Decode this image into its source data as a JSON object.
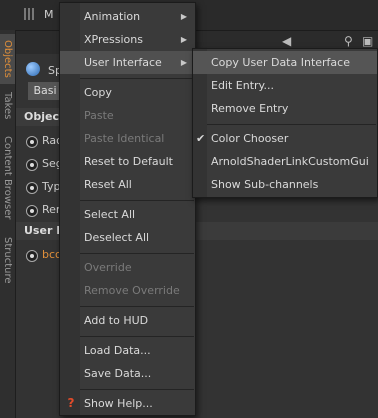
{
  "app": {
    "panel_title": "M",
    "object_prefix": "Sp",
    "basic_tab": "Basi",
    "object_section": "Objec",
    "fields": [
      "Rad",
      "Seg",
      "Typ",
      "Ren"
    ],
    "user_data_section": "User D",
    "user_field": "bco",
    "side_tabs": [
      "Objects",
      "Takes",
      "Content Browser",
      "Structure"
    ]
  },
  "context_menu": {
    "items": [
      {
        "label": "Animation",
        "submenu": true
      },
      {
        "label": "XPressions",
        "submenu": true
      },
      {
        "label": "User Interface",
        "submenu": true,
        "highlighted": true
      },
      {
        "label": "Copy"
      },
      {
        "label": "Paste",
        "disabled": true
      },
      {
        "label": "Paste Identical",
        "disabled": true
      },
      {
        "label": "Reset to Default"
      },
      {
        "label": "Reset All"
      },
      {
        "label": "Select All"
      },
      {
        "label": "Deselect All"
      },
      {
        "label": "Override",
        "disabled": true
      },
      {
        "label": "Remove Override",
        "disabled": true
      },
      {
        "label": "Add to HUD"
      },
      {
        "label": "Load Data..."
      },
      {
        "label": "Save Data..."
      },
      {
        "label": "Show Help..."
      }
    ]
  },
  "submenu": {
    "items": [
      {
        "label": "Copy User Data Interface",
        "highlighted": true
      },
      {
        "label": "Edit Entry..."
      },
      {
        "label": "Remove Entry"
      },
      {
        "label": "Color Chooser",
        "checked": true
      },
      {
        "label": "ArnoldShaderLinkCustomGui"
      },
      {
        "label": "Show Sub-channels"
      }
    ]
  },
  "icons": {
    "submenu_arrow": "▶",
    "check": "✔",
    "help": "?"
  },
  "colors": {
    "menu_bg": "#3a3a3a",
    "highlight": "#505050",
    "accent_orange": "#e08f3a",
    "help_red": "#e04b2a"
  }
}
